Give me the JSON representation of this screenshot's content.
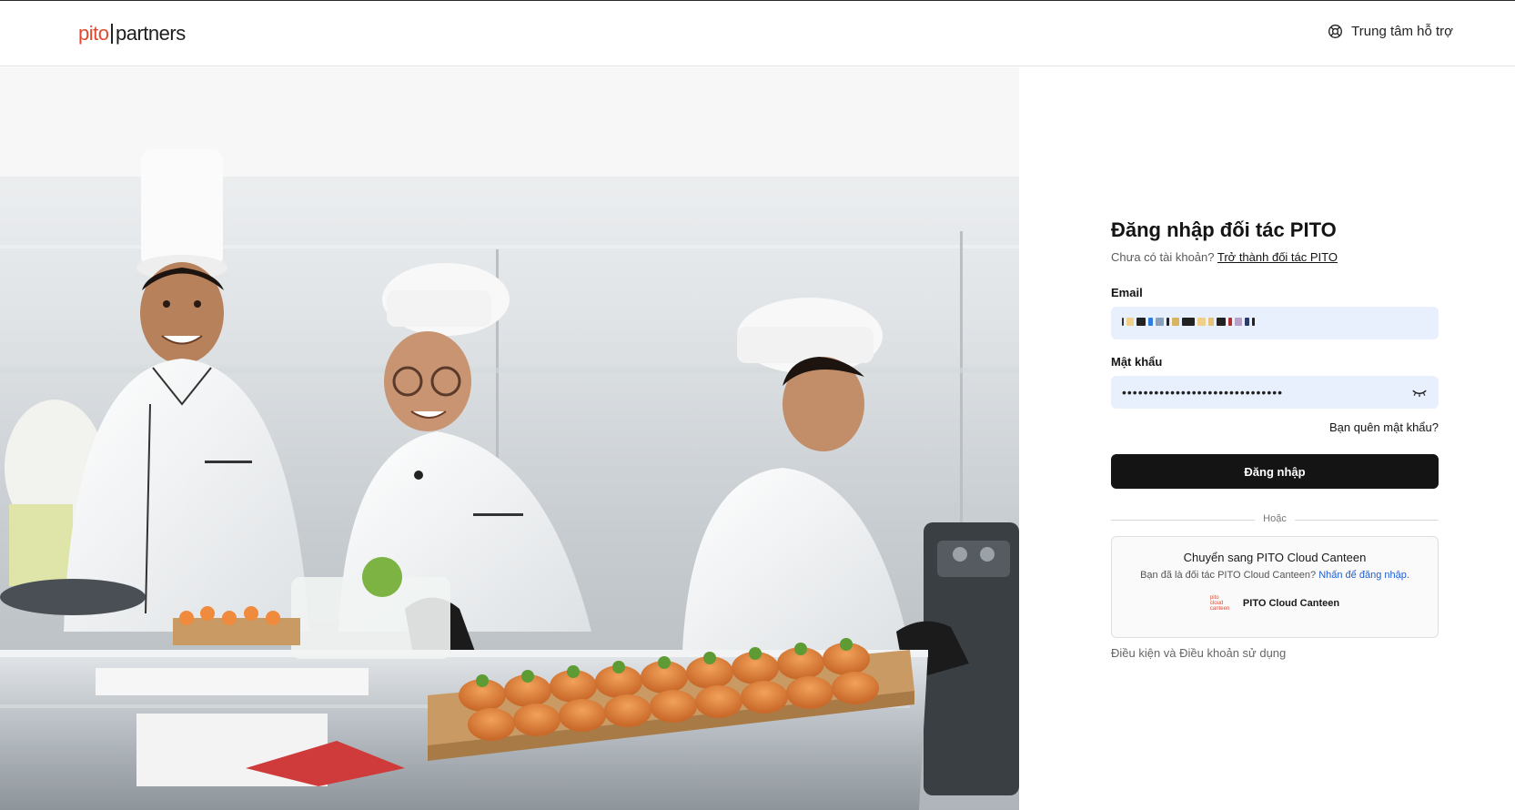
{
  "header": {
    "logo_part1": "pito",
    "logo_part2": "partners",
    "help_label": "Trung tâm hỗ trợ"
  },
  "login": {
    "title": "Đăng nhập đối tác PITO",
    "no_account_text": "Chưa có tài khoản?",
    "become_partner_link": "Trở thành đối tác PITO",
    "email_label": "Email",
    "password_label": "Mật khẩu",
    "password_value": "••••••••••••••••••••••••••••••",
    "forgot_password": "Bạn quên mật khẩu?",
    "submit_label": "Đăng nhập",
    "divider_text": "Hoặc"
  },
  "canteen": {
    "title": "Chuyển sang PITO Cloud Canteen",
    "desc": "Bạn đã là đối tác PITO Cloud Canteen?",
    "desc_link": "Nhấn để đăng nhập.",
    "logo_line1": "pito",
    "logo_line2": "cloud",
    "logo_line3": "canteen",
    "brand_name": "PITO Cloud Canteen"
  },
  "footer": {
    "terms": "Điều kiện và Điều khoản sử dụng"
  },
  "icons": {
    "help": "lifebuoy-icon",
    "eye": "eye-closed-icon"
  },
  "colors": {
    "brand_red": "#e2492f",
    "button_dark": "#141414",
    "input_bg": "#e8f0fe",
    "link_blue": "#1f5fd1"
  }
}
